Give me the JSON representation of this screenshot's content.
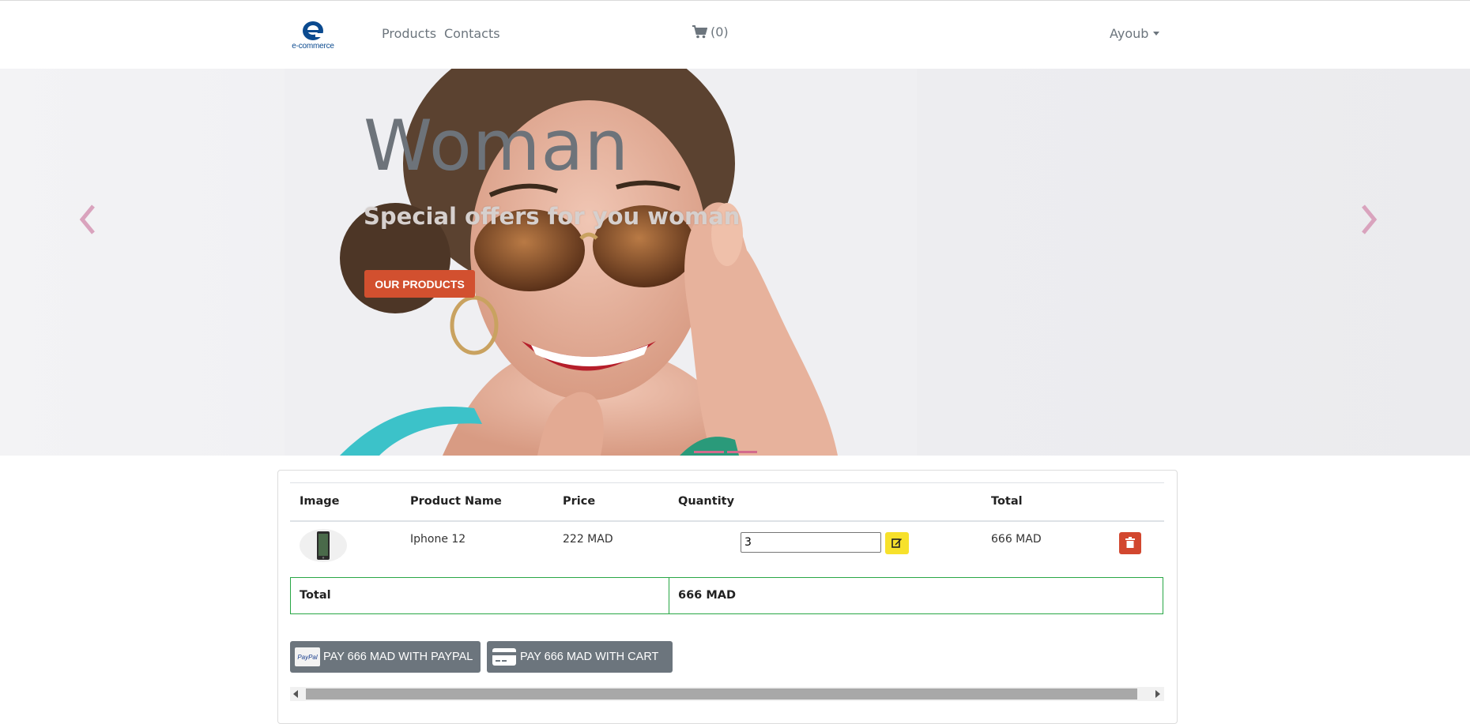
{
  "navbar": {
    "logo_text": "e-commerce",
    "links": [
      "Products",
      "Contacts"
    ],
    "cart_count": "(0)",
    "user_name": "Ayoub",
    "icons": {
      "cart": "shopping-cart-icon",
      "user_menu": "chevron-down-icon"
    }
  },
  "hero": {
    "title": "Woman",
    "subtitle": "Special offers for you woman",
    "button_label": "OUR PRODUCTS",
    "accent_color": "#d2502f",
    "controls_color": "#d46a8c"
  },
  "cart_table": {
    "columns": [
      "Image",
      "Product Name",
      "Price",
      "Quantity",
      "Total"
    ],
    "rows": [
      {
        "product_name": "Iphone 12",
        "price": "222 MAD",
        "quantity": "3",
        "total": "666 MAD"
      }
    ],
    "summary": {
      "label": "Total",
      "value": "666 MAD"
    }
  },
  "payment": {
    "paypal_label": "PAY 666 MAD WITH PAYPAL",
    "paypal_logo_text": "PayPal",
    "cart_label": "PAY 666 MAD WITH CART"
  },
  "colors": {
    "edit_button": "#f7e12b",
    "delete_button": "#d2472f",
    "total_border": "#28a745",
    "pay_buttons": "#6c757d"
  }
}
